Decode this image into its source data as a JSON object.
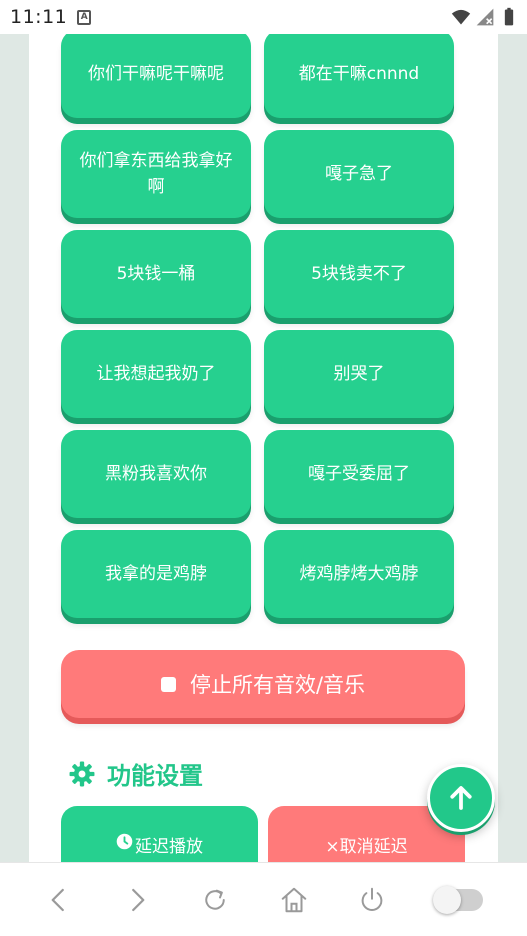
{
  "status": {
    "time": "11:11",
    "sim_label": "A"
  },
  "sound_buttons": [
    {
      "label": "你们干嘛呢干嘛呢"
    },
    {
      "label": "都在干嘛cnnnd"
    },
    {
      "label": "你们拿东西给我拿好啊"
    },
    {
      "label": "嘎子急了"
    },
    {
      "label": "5块钱一桶"
    },
    {
      "label": "5块钱卖不了"
    },
    {
      "label": "让我想起我奶了"
    },
    {
      "label": "别哭了"
    },
    {
      "label": "黑粉我喜欢你"
    },
    {
      "label": "嘎子受委屈了"
    },
    {
      "label": "我拿的是鸡脖"
    },
    {
      "label": "烤鸡脖烤大鸡脖"
    }
  ],
  "stop_all": {
    "label": "停止所有音效/音乐"
  },
  "settings": {
    "title": "功能设置",
    "icon": "gear-icon"
  },
  "delay_button": {
    "label": "延迟播放",
    "icon": "clock-icon"
  },
  "cancel_button": {
    "label": "×取消延迟"
  },
  "fab": {
    "icon": "arrow-up-icon"
  },
  "browser_bar": {
    "icons": [
      "back-icon",
      "forward-icon",
      "reload-icon",
      "home-icon",
      "power-icon",
      "toggle-switch"
    ]
  },
  "colors": {
    "green": "#26d08f",
    "red": "#ff7a7a",
    "title_green": "#22c68a"
  }
}
